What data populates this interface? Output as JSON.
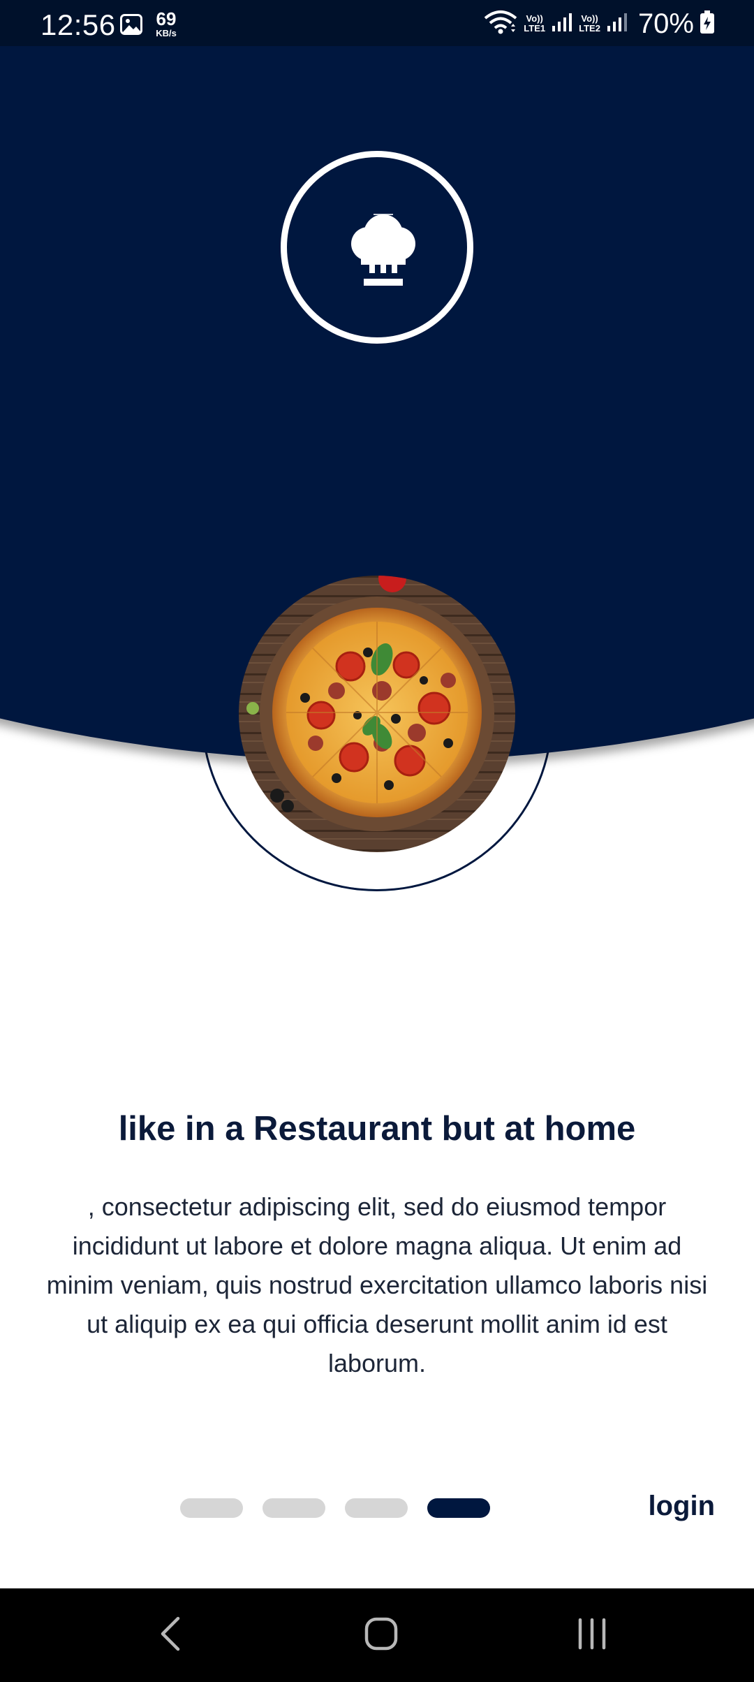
{
  "status_bar": {
    "time": "12:56",
    "net_speed_value": "69",
    "net_speed_unit": "KB/s",
    "sim1_top": "Vo))",
    "sim1_bottom": "LTE1",
    "sim2_top": "Vo))",
    "sim2_bottom": "LTE2",
    "battery": "70%",
    "icons": [
      "gallery-icon",
      "wifi-icon",
      "signal-icon",
      "battery-charging-icon"
    ]
  },
  "hero": {
    "logo_icon": "chef-hat-icon",
    "image": "pizza-photo",
    "background_color": "#00173f"
  },
  "content": {
    "title": "like in a Restaurant but at home",
    "description": ", consectetur adipiscing elit, sed do eiusmod tempor incididunt ut labore et dolore magna aliqua. Ut enim ad minim veniam, quis nostrud exercitation ullamco laboris nisi ut aliquip ex ea qui officia deserunt mollit anim id est laborum."
  },
  "pager": {
    "total": 4,
    "current": 4,
    "active_color": "#00173f",
    "inactive_color": "#d6d6d6"
  },
  "actions": {
    "login_label": "login"
  },
  "nav_bar": {
    "buttons": [
      "back-icon",
      "home-icon",
      "recents-icon"
    ]
  }
}
